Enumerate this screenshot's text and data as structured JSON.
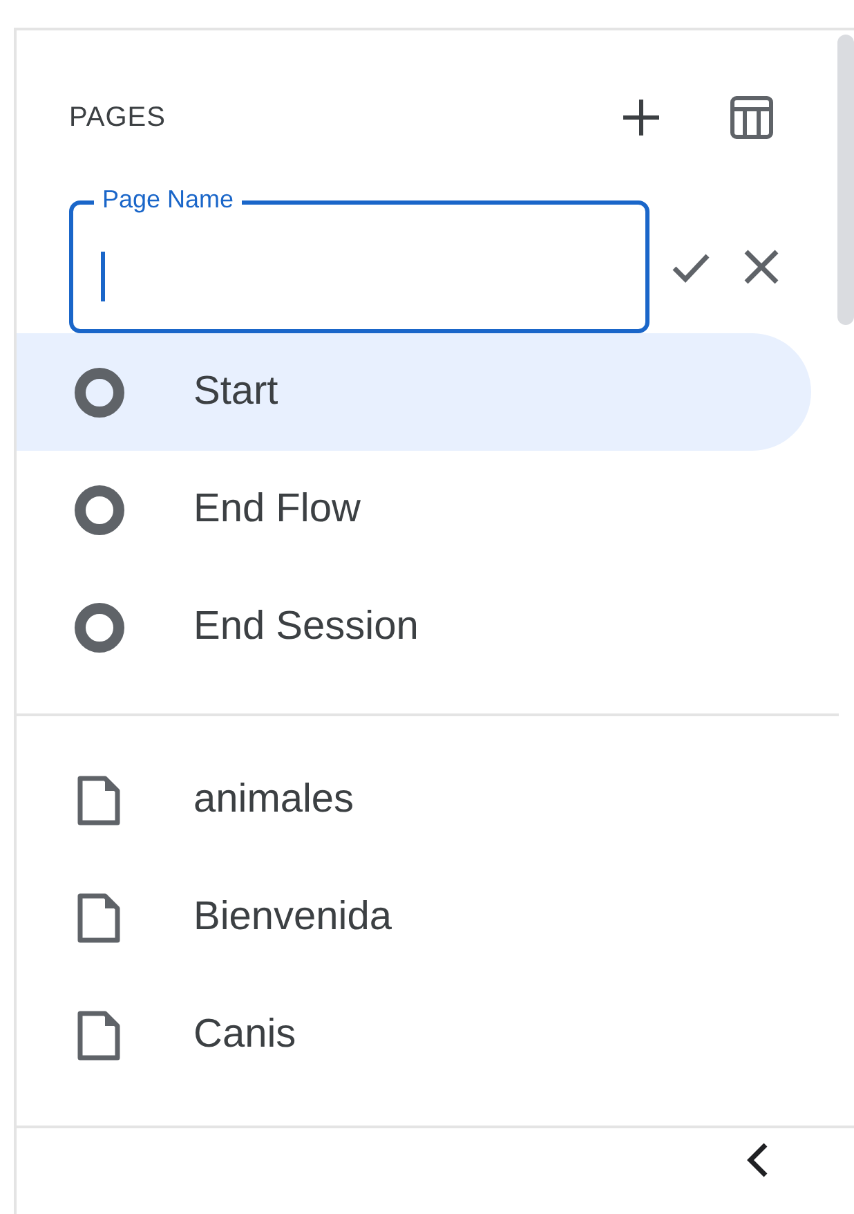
{
  "header": {
    "title": "PAGES"
  },
  "page_name_field": {
    "label": "Page Name",
    "focused": true
  },
  "special_pages": [
    {
      "label": "Start",
      "selected": true
    },
    {
      "label": "End Flow",
      "selected": false
    },
    {
      "label": "End Session",
      "selected": false
    }
  ],
  "pages": [
    {
      "label": "animales",
      "selected": false
    },
    {
      "label": "Bienvenida",
      "selected": false
    },
    {
      "label": "Canis",
      "selected": false
    }
  ]
}
